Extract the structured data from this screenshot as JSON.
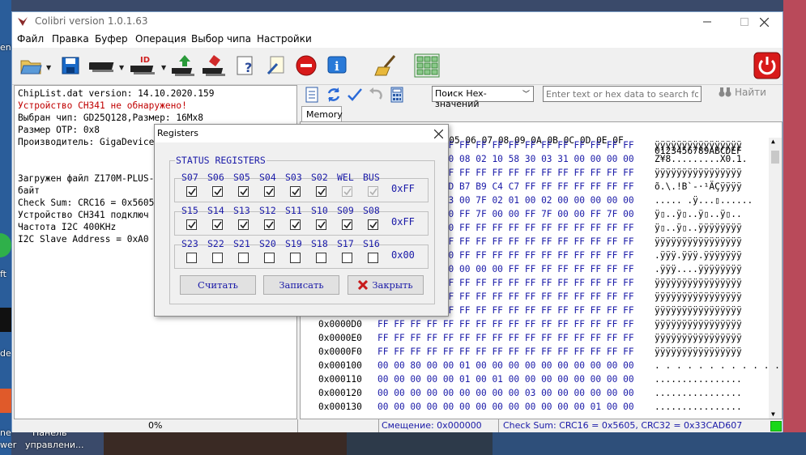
{
  "window": {
    "title": "Colibri version 1.0.1.63"
  },
  "menu": [
    "Файл",
    "Правка",
    "Буфер",
    "Операция",
    "Выбор чипа",
    "Настройки"
  ],
  "log": [
    {
      "text": "ChipList.dat version: 14.10.2020.159",
      "color": "black"
    },
    {
      "text": "Устройство CH341 не обнаружено!",
      "color": "red"
    },
    {
      "text": "Выбран чип: GD25Q128,Размер: 16Mx8",
      "color": "black"
    },
    {
      "text": " Размер OTP: 0x8",
      "color": "black"
    },
    {
      "text": "Производитель: GigaDevice",
      "color": "black"
    },
    {
      "text": "",
      "color": "black"
    },
    {
      "text": "",
      "color": "black"
    },
    {
      "text": "Загружен файл Z170M-PLUS-",
      "color": "black"
    },
    {
      "text": "байт",
      "color": "black"
    },
    {
      "text": "Check Sum: CRC16 = 0x5605",
      "color": "black"
    },
    {
      "text": "Устройство CH341 подключ",
      "color": "black"
    },
    {
      "text": "Частота I2C 400KHz",
      "color": "black"
    },
    {
      "text": "I2C Slave Address = 0xA0",
      "color": "black"
    }
  ],
  "hex": {
    "search_mode": "Поиск Hex-значений",
    "search_placeholder": "Enter text or hex data to search for:",
    "find_label": "Найти",
    "tab": "Memory",
    "header_bytes": "04 05 06 07 08 09 0A 0B 0C 0D 0E 0F",
    "header_ascii": "0123456789ABCDEF",
    "rows": [
      {
        "addr": "",
        "bytes": "FF FF FF FF FF FF FF FF FF FF FF FF FF FF FF FF",
        "ascii": "ÿÿÿÿÿÿÿÿÿÿÿÿÿÿÿÿ"
      },
      {
        "addr": "",
        "bytes": "00 00 00 04 00 08 02 10 58 30 03 31 00 00 00 00",
        "ascii": "Z¥8.........X0.1."
      },
      {
        "addr": "",
        "bytes": "FF FF FF FF FF FF FF FF FF FF FF FF FF FF FF FF",
        "ascii": "ÿÿÿÿÿÿÿÿÿÿÿÿÿÿÿÿ"
      },
      {
        "addr": "",
        "bytes": "00 41 42 60 AD B7 B9 C4 C7 FF FF FF FF FF FF FF",
        "ascii": "õ.\\.!B`-·¹ÄÇÿÿÿÿ"
      },
      {
        "addr": "",
        "bytes": "00 02 02 FF 03 00 7F 02 01 00 02 00 00 00 00 00",
        "ascii": "..... .ÿ...▯......"
      },
      {
        "addr": "",
        "bytes": "00 7F 7F 00 00 FF 7F 00 00 FF 7F 00 00 FF 7F 00",
        "ascii": "ÿ▯..ÿ▯..ÿ▯..ÿ▯.."
      },
      {
        "addr": "",
        "bytes": "00 7F 7F 00 00 FF FF FF FF FF FF FF FF FF FF FF",
        "ascii": "ÿ▯..ÿ▯..ÿÿÿÿÿÿÿÿ"
      },
      {
        "addr": "",
        "bytes": "FF FF FF FF FF FF FF FF FF FF FF FF FF FF FF FF",
        "ascii": "ÿÿÿÿÿÿÿÿÿÿÿÿÿÿÿÿ"
      },
      {
        "addr": "",
        "bytes": "00 FF FF FF 00 FF FF FF FF FF FF FF FF FF FF FF",
        "ascii": ".ÿÿÿ.ÿÿÿ.ÿÿÿÿÿÿÿ"
      },
      {
        "addr": "",
        "bytes": "00 FF FF FF 00 00 00 00 FF FF FF FF FF FF FF FF",
        "ascii": ".ÿÿÿ....ÿÿÿÿÿÿÿÿ"
      },
      {
        "addr": "",
        "bytes": "FF FF FF FF FF FF FF FF FF FF FF FF FF FF FF FF",
        "ascii": "ÿÿÿÿÿÿÿÿÿÿÿÿÿÿÿÿ"
      },
      {
        "addr": "",
        "bytes": "FF FF FF FF FF FF FF FF FF FF FF FF FF FF FF FF",
        "ascii": "ÿÿÿÿÿÿÿÿÿÿÿÿÿÿÿÿ"
      },
      {
        "addr": "",
        "bytes": "FF FF FF FF FF FF FF FF FF FF FF FF FF FF FF FF",
        "ascii": "ÿÿÿÿÿÿÿÿÿÿÿÿÿÿÿÿ"
      },
      {
        "addr": "0x0000D0",
        "bytes": "FF FF FF FF FF FF FF FF FF FF FF FF FF FF FF FF",
        "ascii": "ÿÿÿÿÿÿÿÿÿÿÿÿÿÿÿÿ"
      },
      {
        "addr": "0x0000E0",
        "bytes": "FF FF FF FF FF FF FF FF FF FF FF FF FF FF FF FF",
        "ascii": "ÿÿÿÿÿÿÿÿÿÿÿÿÿÿÿÿ"
      },
      {
        "addr": "0x0000F0",
        "bytes": "FF FF FF FF FF FF FF FF FF FF FF FF FF FF FF FF",
        "ascii": "ÿÿÿÿÿÿÿÿÿÿÿÿÿÿÿÿ"
      },
      {
        "addr": "0x000100",
        "bytes": "00 00 80 00 00 01 00 00 00 00 00 00 00 00 00 00",
        "ascii": ". . . . . . . . . . . ."
      },
      {
        "addr": "0x000110",
        "bytes": "00 00 00 00 00 01 00 01 00 00 00 00 00 00 00 00",
        "ascii": "................"
      },
      {
        "addr": "0x000120",
        "bytes": "00 00 00 00 00 00 00 00 00 03 00 00 00 00 00 00",
        "ascii": "................"
      },
      {
        "addr": "0x000130",
        "bytes": "00 00 00 00 00 00 00 00 00 00 00 00 00 01 00 00",
        "ascii": "................"
      }
    ]
  },
  "status": {
    "progress": "0%",
    "offset": "Смещение: 0x000000",
    "checksum": "Check Sum: CRC16 = 0x5605, CRC32 = 0x33CAD607",
    "led_color": "#18d818"
  },
  "dialog": {
    "title": "Registers",
    "group_title": "STATUS REGISTERS",
    "registers": [
      {
        "labels": [
          "S07",
          "S06",
          "S05",
          "S04",
          "S03",
          "S02",
          "WEL",
          "BUS"
        ],
        "checked": [
          true,
          true,
          true,
          true,
          true,
          true,
          true,
          true
        ],
        "disabled": [
          false,
          false,
          false,
          false,
          false,
          false,
          true,
          true
        ],
        "value": "0xFF"
      },
      {
        "labels": [
          "S15",
          "S14",
          "S13",
          "S12",
          "S11",
          "S10",
          "S09",
          "S08"
        ],
        "checked": [
          true,
          true,
          true,
          true,
          true,
          true,
          true,
          true
        ],
        "disabled": [
          false,
          false,
          false,
          false,
          false,
          false,
          false,
          false
        ],
        "value": "0xFF"
      },
      {
        "labels": [
          "S23",
          "S22",
          "S21",
          "S20",
          "S19",
          "S18",
          "S17",
          "S16"
        ],
        "checked": [
          false,
          false,
          false,
          false,
          false,
          false,
          false,
          false
        ],
        "disabled": [
          false,
          false,
          false,
          false,
          false,
          false,
          false,
          false
        ],
        "value": "0x00"
      }
    ],
    "buttons": {
      "read": "Считать",
      "write": "Записать",
      "close": "Закрыть"
    }
  },
  "desktop": {
    "labels_left": [
      "ent",
      "ft",
      "de"
    ],
    "labels_bottom": [
      "ne",
      "Панель",
      "wer",
      "управлени..."
    ]
  }
}
